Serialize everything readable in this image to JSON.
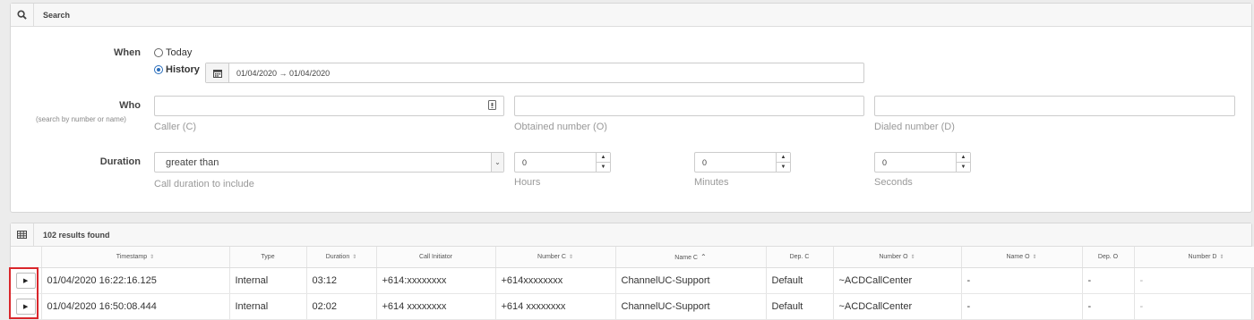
{
  "search": {
    "title": "Search",
    "when_label": "When",
    "today_label": "Today",
    "history_label": "History",
    "date_range": "01/04/2020 → 01/04/2020",
    "who_label": "Who",
    "who_sublabel": "(search by number or name)",
    "caller_help": "Caller (C)",
    "obtained_help": "Obtained number (O)",
    "dialed_help": "Dialed number (D)",
    "duration_label": "Duration",
    "duration_select": "greater than",
    "duration_help": "Call duration to include",
    "hours_value": "0",
    "minutes_value": "0",
    "seconds_value": "0",
    "hours_help": "Hours",
    "minutes_help": "Minutes",
    "seconds_help": "Seconds"
  },
  "results": {
    "count_label": "102 results found",
    "columns": [
      "Timestamp",
      "Type",
      "Duration",
      "Call Initiator",
      "Number C",
      "Name C",
      "Dep. C",
      "Number O",
      "Name O",
      "Dep. O",
      "Number D"
    ],
    "rows": [
      [
        "01/04/2020 16:22:16.125",
        "Internal",
        "03:12",
        "+614:xxxxxxxx",
        "+614xxxxxxxx",
        "ChannelUC-Support",
        "Default",
        "~ACDCallCenter",
        "-",
        "-",
        "-"
      ],
      [
        "01/04/2020 16:50:08.444",
        "Internal",
        "02:02",
        "+614 xxxxxxxx",
        "+614 xxxxxxxx",
        "ChannelUC-Support",
        "Default",
        "~ACDCallCenter",
        "-",
        "-",
        "-"
      ]
    ]
  },
  "colors": {
    "accent": "#2a6ebb",
    "highlight": "#d9262b"
  },
  "icons": {
    "search": "search-icon",
    "calendar": "calendar-icon",
    "grid": "grid-icon",
    "play": "play-icon",
    "contact": "contact-card-icon"
  }
}
